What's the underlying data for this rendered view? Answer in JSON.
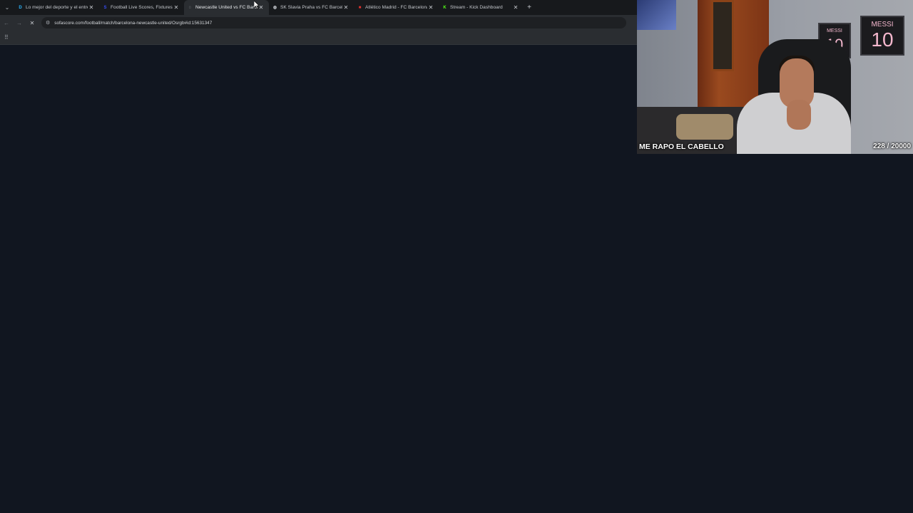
{
  "browser": {
    "tabs": [
      {
        "title": "Lo mejor del deporte y el entre",
        "favicon": "d-icon",
        "favicon_glyph": "D",
        "favicon_color": "#2ab7ff",
        "active": false
      },
      {
        "title": "Football Live Scores, Fixtures &",
        "favicon": "sofascore-icon",
        "favicon_glyph": "S",
        "favicon_color": "#374df5",
        "active": false
      },
      {
        "title": "Newcastle United vs FC Barcelo",
        "favicon": "loading-icon",
        "favicon_glyph": "◌",
        "favicon_color": "#c4c7cc",
        "active": true
      },
      {
        "title": "SK Slavia Praha vs FC Barcelona",
        "favicon": "globe-icon",
        "favicon_glyph": "◍",
        "favicon_color": "#c4c7cc",
        "active": false
      },
      {
        "title": "Atlético Madrid - FC Barcelona",
        "favicon": "red-icon",
        "favicon_glyph": "■",
        "favicon_color": "#e5322d",
        "active": false
      },
      {
        "title": "Stream - Kick Dashboard",
        "favicon": "kick-icon",
        "favicon_glyph": "K",
        "favicon_color": "#53fc18",
        "active": false
      }
    ],
    "close_glyph": "✕",
    "new_tab_glyph": "+",
    "tab_menu_glyph": "⌄",
    "url": "sofascore.com/football/match/barcelona-newcastle-united/Osrgb#id:15631347",
    "back_glyph": "←",
    "forward_glyph": "→",
    "reload_glyph": "✕",
    "site_info_glyph": "⚙",
    "apps_glyph": "⠿"
  },
  "webcam": {
    "caption": "ME RAPO EL CABELLO",
    "counter": "228 / 20000",
    "frame_left_text": "MESSI",
    "frame_left_number": "10",
    "frame_right_text": "MESSI",
    "frame_right_number": "10"
  }
}
